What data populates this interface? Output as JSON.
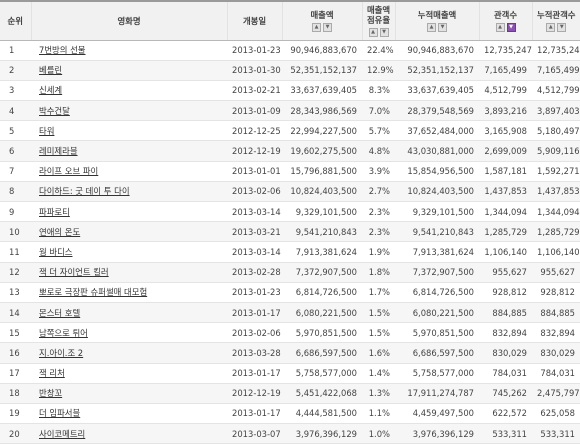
{
  "headers": {
    "rank": "순위",
    "title": "영화명",
    "open_date": "개봉일",
    "sales": "매출액",
    "share_line1": "매출액",
    "share_line2": "점유율",
    "cum_sales": "누적매출액",
    "audience": "관객수",
    "cum_audience": "누적관객수"
  },
  "sort_icons": {
    "asc": "up-arrow",
    "desc": "down-arrow",
    "active_color": "#8c4fb5"
  },
  "rows": [
    {
      "rank": "1",
      "title": "7번방의 선물",
      "open_date": "2013-01-23",
      "sales": "90,946,883,670",
      "share": "22.4%",
      "cum_sales": "90,946,883,670",
      "audience": "12,735,247",
      "cum_audience": "12,735,247"
    },
    {
      "rank": "2",
      "title": "베를린",
      "open_date": "2013-01-30",
      "sales": "52,351,152,137",
      "share": "12.9%",
      "cum_sales": "52,351,152,137",
      "audience": "7,165,499",
      "cum_audience": "7,165,499"
    },
    {
      "rank": "3",
      "title": "신세계",
      "open_date": "2013-02-21",
      "sales": "33,637,639,405",
      "share": "8.3%",
      "cum_sales": "33,637,639,405",
      "audience": "4,512,799",
      "cum_audience": "4,512,799"
    },
    {
      "rank": "4",
      "title": "박수건달",
      "open_date": "2013-01-09",
      "sales": "28,343,986,569",
      "share": "7.0%",
      "cum_sales": "28,379,548,569",
      "audience": "3,893,216",
      "cum_audience": "3,897,403"
    },
    {
      "rank": "5",
      "title": "타워",
      "open_date": "2012-12-25",
      "sales": "22,994,227,500",
      "share": "5.7%",
      "cum_sales": "37,652,484,000",
      "audience": "3,165,908",
      "cum_audience": "5,180,497"
    },
    {
      "rank": "6",
      "title": "레미제라블",
      "open_date": "2012-12-19",
      "sales": "19,602,275,500",
      "share": "4.8%",
      "cum_sales": "43,030,881,000",
      "audience": "2,699,009",
      "cum_audience": "5,909,116"
    },
    {
      "rank": "7",
      "title": "라이프 오브 파이",
      "open_date": "2013-01-01",
      "sales": "15,796,881,500",
      "share": "3.9%",
      "cum_sales": "15,854,956,500",
      "audience": "1,587,181",
      "cum_audience": "1,592,271"
    },
    {
      "rank": "8",
      "title": "다이하드: 굿 데이 투 다이",
      "open_date": "2013-02-06",
      "sales": "10,824,403,500",
      "share": "2.7%",
      "cum_sales": "10,824,403,500",
      "audience": "1,437,853",
      "cum_audience": "1,437,853"
    },
    {
      "rank": "9",
      "title": "파파로티",
      "open_date": "2013-03-14",
      "sales": "9,329,101,500",
      "share": "2.3%",
      "cum_sales": "9,329,101,500",
      "audience": "1,344,094",
      "cum_audience": "1,344,094"
    },
    {
      "rank": "10",
      "title": "연애의 온도",
      "open_date": "2013-03-21",
      "sales": "9,541,210,843",
      "share": "2.3%",
      "cum_sales": "9,541,210,843",
      "audience": "1,285,729",
      "cum_audience": "1,285,729"
    },
    {
      "rank": "11",
      "title": "웜 바디스",
      "open_date": "2013-03-14",
      "sales": "7,913,381,624",
      "share": "1.9%",
      "cum_sales": "7,913,381,624",
      "audience": "1,106,140",
      "cum_audience": "1,106,140"
    },
    {
      "rank": "12",
      "title": "잭 더 자이언트 킬러",
      "open_date": "2013-02-28",
      "sales": "7,372,907,500",
      "share": "1.8%",
      "cum_sales": "7,372,907,500",
      "audience": "955,627",
      "cum_audience": "955,627"
    },
    {
      "rank": "13",
      "title": "뽀로로 극장판 슈퍼썰매 대모험",
      "open_date": "2013-01-23",
      "sales": "6,814,726,500",
      "share": "1.7%",
      "cum_sales": "6,814,726,500",
      "audience": "928,812",
      "cum_audience": "928,812"
    },
    {
      "rank": "14",
      "title": "몬스터 호텔",
      "open_date": "2013-01-17",
      "sales": "6,080,221,500",
      "share": "1.5%",
      "cum_sales": "6,080,221,500",
      "audience": "884,885",
      "cum_audience": "884,885"
    },
    {
      "rank": "15",
      "title": "남쪽으로 튀어",
      "open_date": "2013-02-06",
      "sales": "5,970,851,500",
      "share": "1.5%",
      "cum_sales": "5,970,851,500",
      "audience": "832,894",
      "cum_audience": "832,894"
    },
    {
      "rank": "16",
      "title": "지.아이.조 2",
      "open_date": "2013-03-28",
      "sales": "6,686,597,500",
      "share": "1.6%",
      "cum_sales": "6,686,597,500",
      "audience": "830,029",
      "cum_audience": "830,029"
    },
    {
      "rank": "17",
      "title": "잭 리처",
      "open_date": "2013-01-17",
      "sales": "5,758,577,000",
      "share": "1.4%",
      "cum_sales": "5,758,577,000",
      "audience": "784,031",
      "cum_audience": "784,031"
    },
    {
      "rank": "18",
      "title": "반창꼬",
      "open_date": "2012-12-19",
      "sales": "5,451,422,068",
      "share": "1.3%",
      "cum_sales": "17,911,274,787",
      "audience": "745,262",
      "cum_audience": "2,475,797"
    },
    {
      "rank": "19",
      "title": "더 임파서블",
      "open_date": "2013-01-17",
      "sales": "4,444,581,500",
      "share": "1.1%",
      "cum_sales": "4,459,497,500",
      "audience": "622,572",
      "cum_audience": "625,058"
    },
    {
      "rank": "20",
      "title": "사이코메트리",
      "open_date": "2013-03-07",
      "sales": "3,976,396,129",
      "share": "1.0%",
      "cum_sales": "3,976,396,129",
      "audience": "533,311",
      "cum_audience": "533,311"
    }
  ]
}
